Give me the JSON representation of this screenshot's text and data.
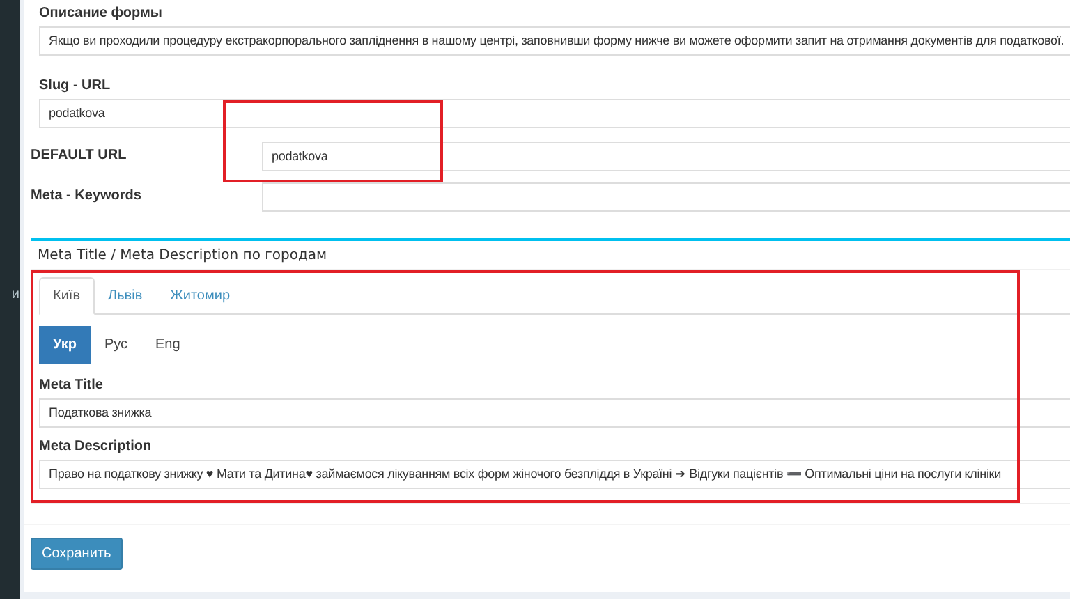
{
  "sidebar": {
    "items": [
      {
        "label": "и"
      }
    ]
  },
  "form": {
    "description_label": "Описание формы",
    "description_value": "Якщо ви проходили процедуру екстракорпорального запліднення в нашому центрі, заповнивши форму нижче ви можете оформити запит на отримання документів для податкової.",
    "slug_label": "Slug - URL",
    "slug_value": "podatkova",
    "default_url_label": "DEFAULT URL",
    "default_url_value": "podatkova",
    "default_url_highlighted": true,
    "keywords_label": "Meta - Keywords"
  },
  "meta_section": {
    "highlighted": true,
    "title": "Meta Title / Meta Description по городам",
    "city_tabs": [
      {
        "label": "Київ",
        "selected": true
      },
      {
        "label": "Львів",
        "selected": false
      },
      {
        "label": "Житомир",
        "selected": false
      }
    ],
    "language_tabs": [
      {
        "label": "Укр",
        "selected": true
      },
      {
        "label": "Рус",
        "selected": false
      },
      {
        "label": "Eng",
        "selected": false
      }
    ],
    "meta_title_label": "Meta Title",
    "meta_title_value": "Податкова знижка",
    "meta_description_label": "Meta Description",
    "meta_description_value": "Право на податкову знижку ♥ Мати та Дитина♥  займаємося лікуванням всіх форм жіночого безпліддя в Україні ➔ Відгуки пацієнтів ➖ Оптимальні ціни на послуги клініки"
  },
  "save_button": "Сохранить"
}
